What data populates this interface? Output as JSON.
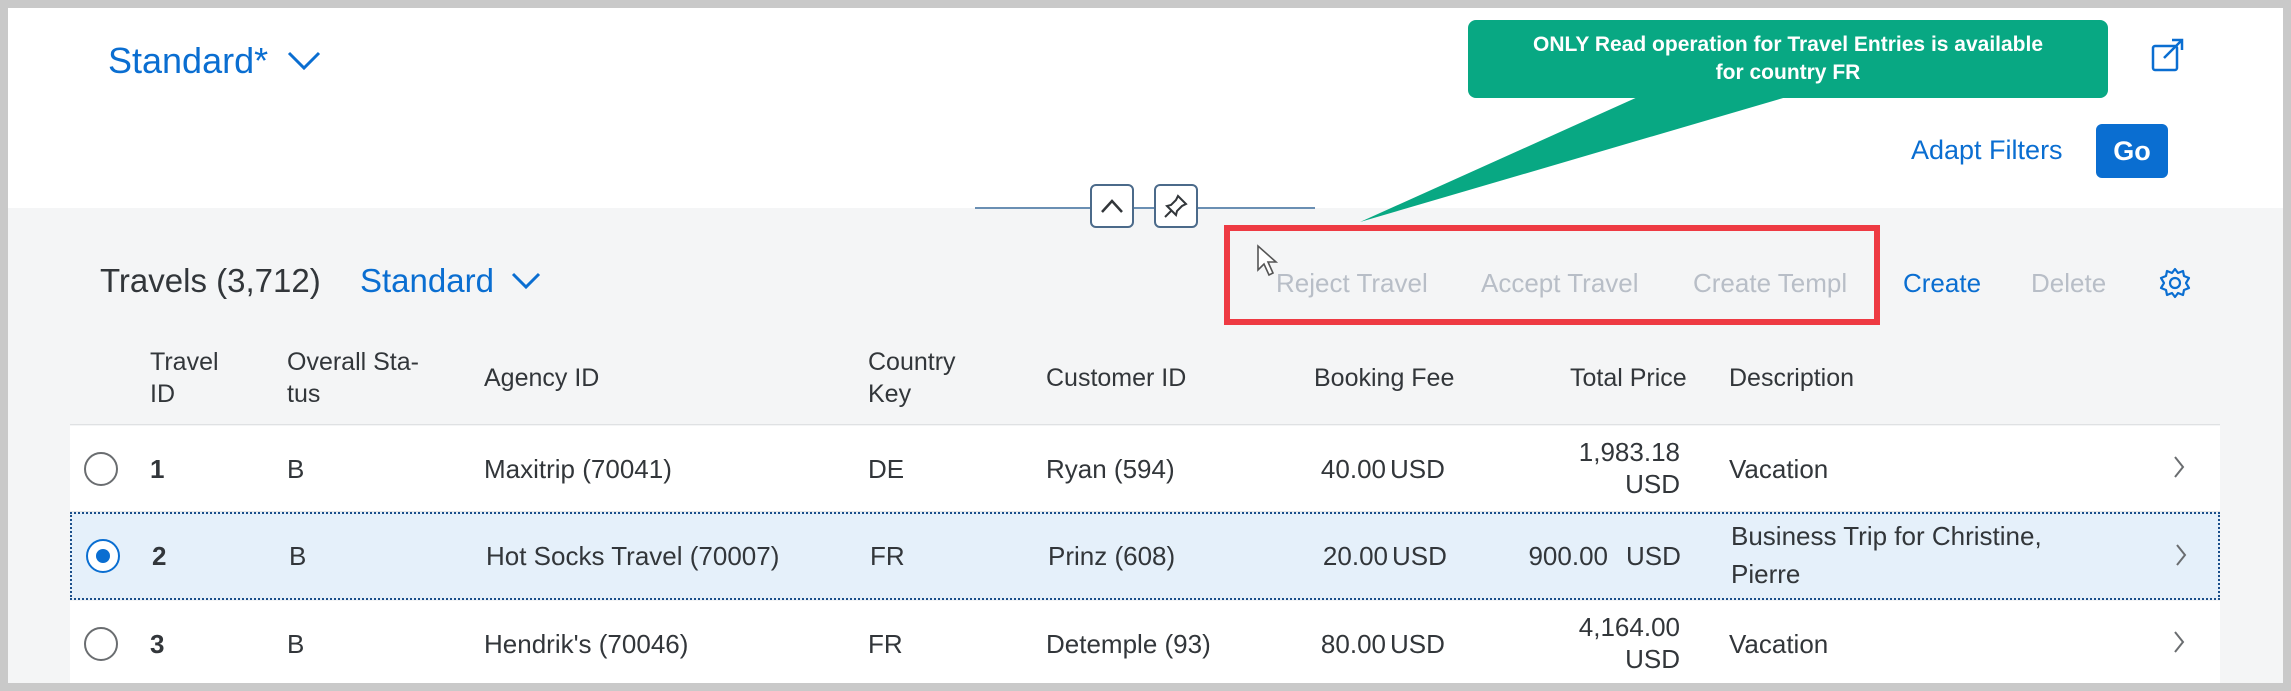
{
  "header": {
    "variant_title": "Standard*",
    "adapt_filters_label": "Adapt Filters",
    "go_label": "Go"
  },
  "callout": {
    "line1": "ONLY Read operation for Travel Entries is available",
    "line2": "for country FR"
  },
  "table_toolbar": {
    "title": "Travels (3,712)",
    "variant_label": "Standard",
    "reject_label": "Reject Travel",
    "accept_label": "Accept Travel",
    "create_template_label": "Create Templ",
    "create_label": "Create",
    "delete_label": "Delete"
  },
  "columns": {
    "travel_id": [
      "Travel",
      "ID"
    ],
    "overall_status": [
      "Overall Sta-",
      "tus"
    ],
    "agency_id": "Agency ID",
    "country_key": [
      "Country",
      "Key"
    ],
    "customer_id": "Customer ID",
    "booking_fee": "Booking Fee",
    "total_price": "Total Price",
    "description": "Description"
  },
  "rows": [
    {
      "travel_id": "1",
      "status": "B",
      "agency": "Maxitrip (70041)",
      "country": "DE",
      "customer": "Ryan (594)",
      "fee": "40.00",
      "fee_currency": "USD",
      "total_line1": "1,983.18",
      "total_line2": "USD",
      "description_line1": "Vacation",
      "description_line2": "",
      "selected": false
    },
    {
      "travel_id": "2",
      "status": "B",
      "agency": "Hot Socks Travel (70007)",
      "country": "FR",
      "customer": "Prinz (608)",
      "fee": "20.00",
      "fee_currency": "USD",
      "total_line1": "900.00",
      "total_line2": "USD",
      "description_line1": "Business Trip for Christine,",
      "description_line2": "Pierre",
      "selected": true
    },
    {
      "travel_id": "3",
      "status": "B",
      "agency": "Hendrik's (70046)",
      "country": "FR",
      "customer": "Detemple (93)",
      "fee": "80.00",
      "fee_currency": "USD",
      "total_line1": "4,164.00",
      "total_line2": "USD",
      "description_line1": "Vacation",
      "description_line2": "",
      "selected": false
    }
  ],
  "colors": {
    "accent": "#0a6ed1",
    "callout": "#08a883",
    "highlight_box": "#ee3a43",
    "selected_row": "#e5f0fa",
    "disabled_text": "#b8bec7"
  },
  "icons": {
    "variant_dropdown": "chevron-down-icon",
    "share": "share-icon",
    "collapse": "chevron-up-icon",
    "pin": "pin-icon",
    "settings": "gear-icon",
    "row_navigation": "chevron-right-icon"
  }
}
